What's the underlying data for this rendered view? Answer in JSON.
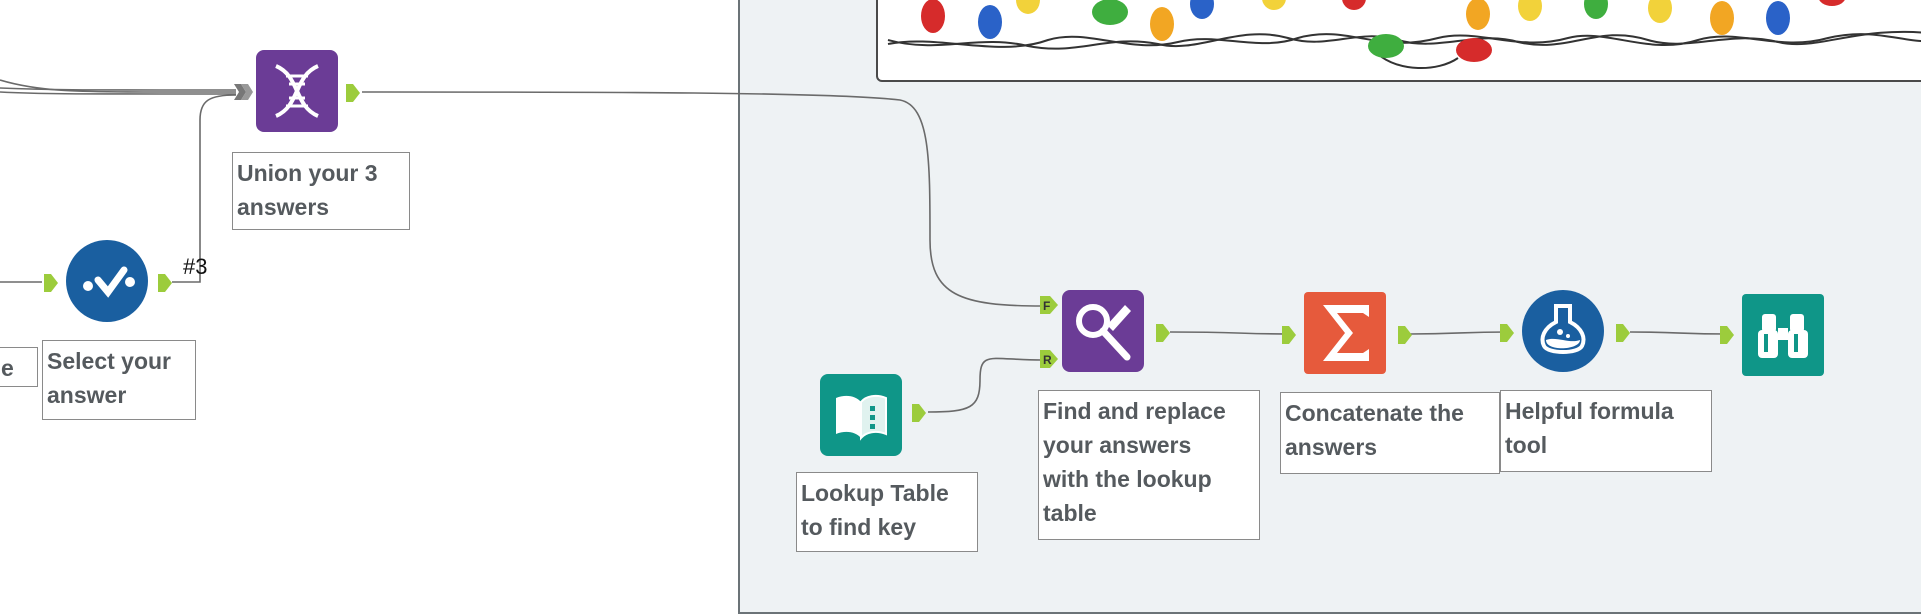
{
  "canvas": {
    "colors": {
      "container_bg": "#eef2f4",
      "anchor_green": "#9ccc3c",
      "wire": "#555555",
      "purple_tool": "#6b3c96",
      "blue_tool": "#1a5fa0",
      "teal_tool": "#0f9688",
      "orange_tool": "#e65a3c"
    }
  },
  "tools": {
    "union": {
      "icon": "dna-union-icon",
      "label": "Union your 3\nanswers"
    },
    "select": {
      "icon": "check-circle-icon",
      "label": "Select your\nanswer"
    },
    "left_partial": {
      "label": "e"
    },
    "lookup": {
      "icon": "book-input-icon",
      "label": "Lookup Table\nto find key"
    },
    "find_replace": {
      "icon": "find-replace-icon",
      "label": "Find and replace\nyour answers\nwith the lookup\ntable",
      "anchors": [
        "F",
        "R"
      ]
    },
    "summarize": {
      "icon": "sigma-icon",
      "label": "Concatenate the\nanswers"
    },
    "formula": {
      "icon": "flask-icon",
      "label": "Helpful formula\ntool"
    },
    "browse": {
      "icon": "binoculars-icon"
    }
  },
  "connections": {
    "select_to_union_label": "#3"
  }
}
